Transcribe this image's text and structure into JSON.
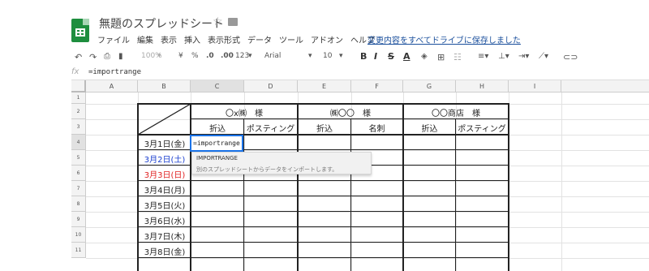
{
  "doc": {
    "title": "無題のスプレッドシート"
  },
  "menu": [
    "ファイル",
    "編集",
    "表示",
    "挿入",
    "表示形式",
    "データ",
    "ツール",
    "アドオン",
    "ヘルプ"
  ],
  "save_link": "変更内容をすべてドライブに保存しました",
  "toolbar": {
    "zoom": "100%",
    "currency": "¥",
    "percent": "%",
    "dec_less": ".0",
    "dec_more": ".00",
    "format": "123",
    "font": "Arial",
    "size": "10",
    "bold": "B",
    "italic": "I",
    "strike": "S",
    "textcolor": "A"
  },
  "formula_bar": {
    "fx": "fx",
    "value": "=importrange"
  },
  "columns": [
    "A",
    "B",
    "C",
    "D",
    "E",
    "F",
    "G",
    "H",
    "I"
  ],
  "rows": [
    "1",
    "2",
    "3",
    "4",
    "5",
    "6",
    "7",
    "8",
    "9",
    "10",
    "11"
  ],
  "table": {
    "groups": [
      "〇x㈱　様",
      "㈱〇〇　様",
      "〇〇商店　様"
    ],
    "subheaders": [
      "折込",
      "ポスティング",
      "折込",
      "名刺",
      "折込",
      "ポスティング"
    ],
    "dates": [
      "3月1日(金)",
      "3月2日(土)",
      "3月3日(日)",
      "3月4日(月)",
      "3月5日(火)",
      "3月6日(水)",
      "3月7日(木)",
      "3月8日(金)"
    ]
  },
  "editing_cell": "=importrange",
  "suggestion": {
    "name": "IMPORTRANGE",
    "description": "別のスプレッドシートからデータをインポートします。"
  },
  "colors": {
    "weekday": "#222222",
    "saturday": "#1a3fcf",
    "sunday": "#e02020",
    "selection": "#1a73e8",
    "sheets_green": "#1e8e3e"
  }
}
